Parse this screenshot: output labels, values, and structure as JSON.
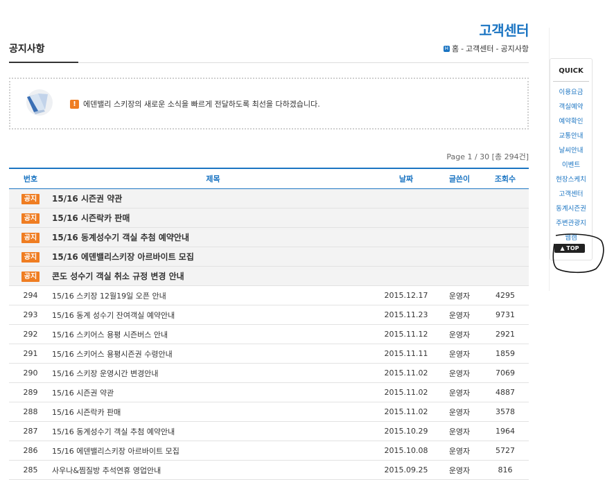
{
  "header": {
    "section_title": "고객센터",
    "page_title": "공지사항",
    "breadcrumb": [
      "홈",
      "고객센터",
      "공지사항"
    ],
    "breadcrumb_sep": "-"
  },
  "notice_banner": {
    "text": "에덴밸리 스키장의 새로운 소식을 빠르게 전달하도록 최선을 다하겠습니다.",
    "warn_glyph": "!"
  },
  "pagination": {
    "info": "Page 1 / 30  [총 294건]"
  },
  "table": {
    "headers": {
      "no": "번호",
      "title": "제목",
      "date": "날짜",
      "writer": "글쓴이",
      "views": "조회수"
    },
    "notice_badge": "공지",
    "notices": [
      "15/16 시즌권 약관",
      "15/16 시즌락카 판매",
      "15/16 동계성수기 객실 추첨 예약안내",
      "15/16 에덴밸리스키장 아르바이트 모집",
      "콘도 성수기 객실 취소 규정 변경 안내"
    ],
    "rows": [
      {
        "no": "294",
        "title": "15/16 스키장 12월19일 오픈 안내",
        "date": "2015.12.17",
        "writer": "운영자",
        "views": "4295"
      },
      {
        "no": "293",
        "title": "15/16 동계 성수기 잔여객실 예약안내",
        "date": "2015.11.23",
        "writer": "운영자",
        "views": "9731"
      },
      {
        "no": "292",
        "title": "15/16 스키어스 용평 시즌버스 안내",
        "date": "2015.11.12",
        "writer": "운영자",
        "views": "2921"
      },
      {
        "no": "291",
        "title": "15/16 스키어스 용평시즌권 수령안내",
        "date": "2015.11.11",
        "writer": "운영자",
        "views": "1859"
      },
      {
        "no": "290",
        "title": "15/16 스키장 운영시간 변경안내",
        "date": "2015.11.02",
        "writer": "운영자",
        "views": "7069"
      },
      {
        "no": "289",
        "title": "15/16 시즌권 약관",
        "date": "2015.11.02",
        "writer": "운영자",
        "views": "4887"
      },
      {
        "no": "288",
        "title": "15/16 시즌락카 판매",
        "date": "2015.11.02",
        "writer": "운영자",
        "views": "3578"
      },
      {
        "no": "287",
        "title": "15/16 동계성수기 객실 추첨 예약안내",
        "date": "2015.10.29",
        "writer": "운영자",
        "views": "1964"
      },
      {
        "no": "286",
        "title": "15/16 에덴밸리스키장 아르바이트 모집",
        "date": "2015.10.08",
        "writer": "운영자",
        "views": "5727"
      },
      {
        "no": "285",
        "title": "사우나&찜질방 추석연휴 영업안내",
        "date": "2015.09.25",
        "writer": "운영자",
        "views": "816"
      }
    ]
  },
  "quick_menu": {
    "title": "QUICK",
    "items": [
      "이용요금",
      "객실예약",
      "예약확인",
      "교통안내",
      "날씨안내",
      "이벤트",
      "현장스케치",
      "고객센터",
      "동계시즌권",
      "주변관광지",
      "웹캠"
    ],
    "top_label": "▲ TOP"
  },
  "colors": {
    "accent": "#1a74c2",
    "badge": "#ef7d22"
  }
}
